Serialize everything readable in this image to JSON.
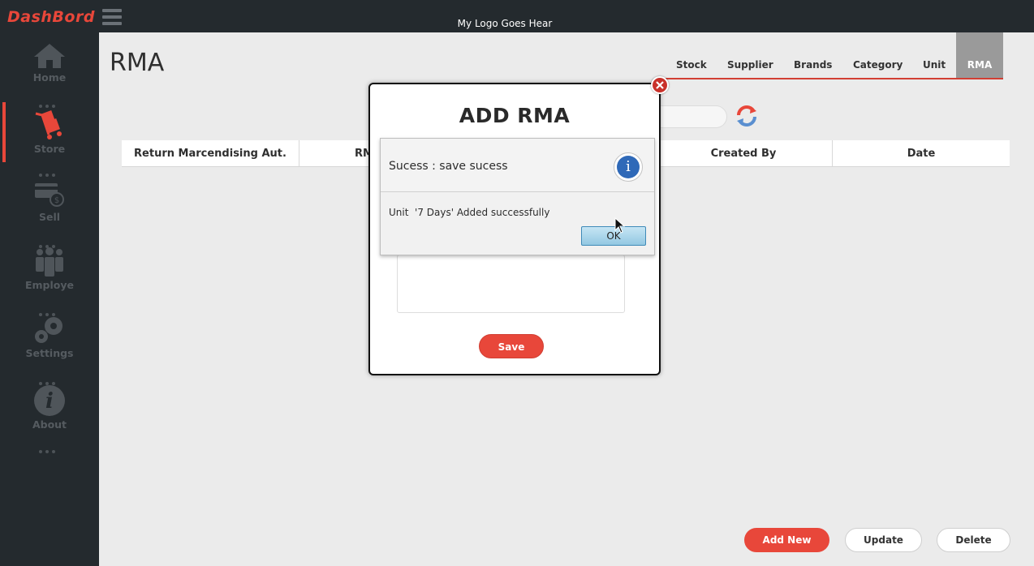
{
  "topbar": {
    "brand": "DashBord",
    "logo_text": "My Logo Goes Hear"
  },
  "sidebar": {
    "items": [
      {
        "label": "Home",
        "icon": "home-icon"
      },
      {
        "label": "Store",
        "icon": "store-cart-icon",
        "active": true
      },
      {
        "label": "Sell",
        "icon": "sell-card-icon"
      },
      {
        "label": "Employe",
        "icon": "employees-icon"
      },
      {
        "label": "Settings",
        "icon": "gears-icon"
      },
      {
        "label": "About",
        "icon": "info-icon"
      }
    ]
  },
  "main": {
    "page_title": "RMA",
    "tabs": [
      "Stock",
      "Supplier",
      "Brands",
      "Category",
      "Unit",
      "RMA"
    ],
    "active_tab": "RMA",
    "table": {
      "columns": [
        "Return Marcendising Aut.",
        "RM",
        "Created By",
        "Date"
      ]
    },
    "buttons": {
      "add_new": "Add New",
      "update": "Update",
      "delete": "Delete"
    }
  },
  "modal": {
    "title": "ADD RMA",
    "save": "Save"
  },
  "dialog": {
    "header": "Sucess : save sucess",
    "message": "Unit  '7 Days' Added successfully",
    "ok": "OK"
  },
  "colors": {
    "accent": "#e8473a",
    "sidebar_bg": "#242a2e",
    "info_blue": "#2f69b8"
  }
}
